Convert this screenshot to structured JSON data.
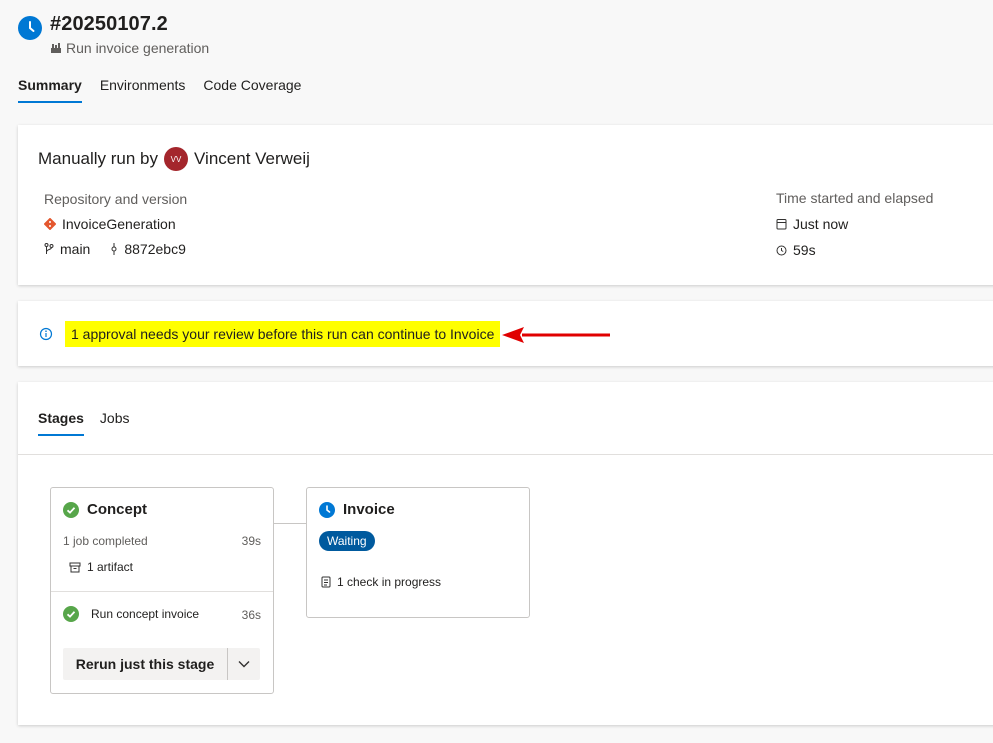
{
  "header": {
    "run_id": "#20250107.2",
    "pipeline_name": "Run invoice generation"
  },
  "tabs": [
    "Summary",
    "Environments",
    "Code Coverage"
  ],
  "run_info": {
    "manual_prefix": "Manually run by",
    "user_initials": "VV",
    "user_name": "Vincent Verweij",
    "repo_label": "Repository and version",
    "repo_name": "InvoiceGeneration",
    "branch": "main",
    "commit": "8872ebc9",
    "time_label": "Time started and elapsed",
    "started": "Just now",
    "elapsed": "59s"
  },
  "banner": {
    "message": "1 approval needs your review before this run can continue to Invoice"
  },
  "stage_tabs": [
    "Stages",
    "Jobs"
  ],
  "stages": {
    "concept": {
      "name": "Concept",
      "jobs_completed": "1 job completed",
      "duration": "39s",
      "artifacts": "1 artifact",
      "job_name": "Run concept invoice",
      "job_duration": "36s",
      "rerun_label": "Rerun just this stage"
    },
    "invoice": {
      "name": "Invoice",
      "status": "Waiting",
      "checks": "1 check in progress"
    }
  },
  "colors": {
    "accent": "#0078d4",
    "success": "#57a64a",
    "waiting_badge": "#005a9e",
    "highlight": "#ffff00",
    "arrow": "#e00000",
    "avatar": "#a4262c"
  }
}
